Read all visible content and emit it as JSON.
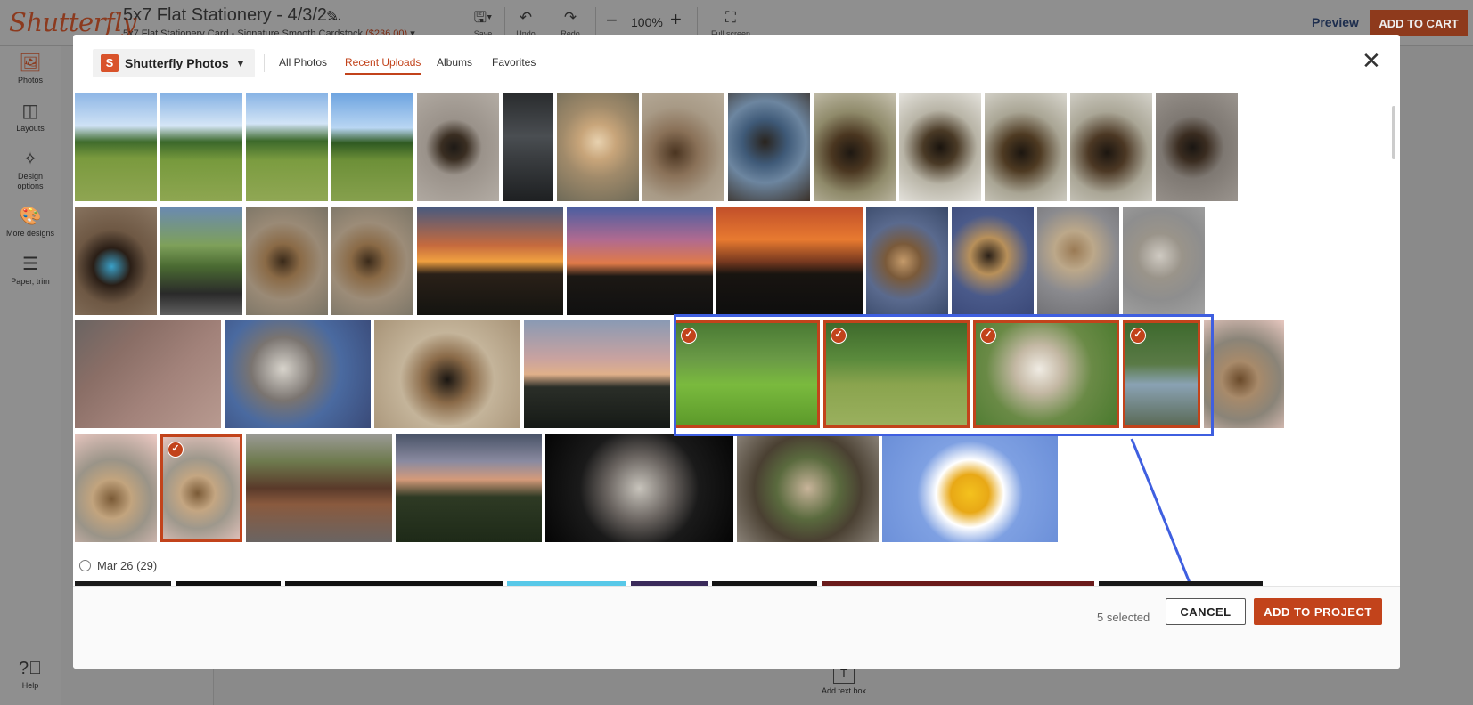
{
  "app": {
    "logo": "Shutterfly",
    "project_title": "5x7 Flat Stationery - 4/3/2...",
    "project_sub": "5x7 Flat Stationery Card - Signature Smooth Cardstock",
    "project_price": "($236.00)"
  },
  "toolbar": {
    "save": "Save",
    "undo": "Undo",
    "redo": "Redo",
    "zoom": "100%",
    "fullscreen": "Full screen",
    "preview": "Preview",
    "add_to_cart": "ADD TO CART"
  },
  "sidebar": {
    "items": [
      {
        "label": "Photos",
        "icon": "photos-icon"
      },
      {
        "label": "Layouts",
        "icon": "layouts-icon"
      },
      {
        "label": "Design options",
        "icon": "design-options-icon"
      },
      {
        "label": "More designs",
        "icon": "palette-icon"
      },
      {
        "label": "Paper, trim",
        "icon": "list-icon"
      }
    ],
    "help": "Help"
  },
  "canvas": {
    "add_text_box": "Add text box"
  },
  "modal": {
    "source": "Shutterfly Photos",
    "tabs": [
      "All Photos",
      "Recent Uploads",
      "Albums",
      "Favorites"
    ],
    "active_tab": "Recent Uploads",
    "date_group": "Mar 26 (29)",
    "selected_count": "5 selected",
    "cancel": "CANCEL",
    "add_to_project": "ADD TO PROJECT"
  },
  "colors": {
    "accent": "#c2431b",
    "selection_frame": "#3f5fe0",
    "brand_dark": "#8c3a1e"
  },
  "photos": [
    {
      "name": "photo-horses-1",
      "selected": false,
      "bg": "linear-gradient(180deg,#8fb7e6 0%,#cfe2f5 30%,#3f6b2c 45%,#7a9a3e 60%,#8fa552 100%)"
    },
    {
      "name": "photo-horses-2",
      "selected": false,
      "bg": "linear-gradient(180deg,#86b2e4 0%,#d6e6f6 30%,#3a672a 45%,#779a3d 62%,#8ea651 100%)"
    },
    {
      "name": "photo-horses-3",
      "selected": false,
      "bg": "linear-gradient(180deg,#89b4e5 0%,#d2e4f6 28%,#3c692b 44%,#7b9c40 62%,#90a754 100%)"
    },
    {
      "name": "photo-horses-4",
      "selected": false,
      "bg": "linear-gradient(180deg,#6ea4e0 0%,#b9d6f3 32%,#2f5a22 46%,#6d9038 62%,#86a04d 100%)"
    },
    {
      "name": "photo-dog-toy",
      "selected": false,
      "bg": "radial-gradient(circle at 45% 50%,#1e1a16 0%,#3a2e22 18%,#9a928a 40%,#b3aca4 100%)"
    },
    {
      "name": "photo-phone-screenshot",
      "selected": false,
      "bg": "linear-gradient(180deg,#2a2c2e 0%,#4a4e52 40%,#3a3d40 60%,#1e2022 100%)"
    },
    {
      "name": "photo-dog-blanket",
      "selected": false,
      "bg": "radial-gradient(circle at 50% 45%,#e8d2b0 0%,#c8a57a 25%,#a08a6a 50%,#6e6a58 100%)"
    },
    {
      "name": "photo-dog-floor",
      "selected": false,
      "bg": "radial-gradient(circle at 40% 55%,#4a3420 0%,#8a7158 30%,#a89a86 60%,#b8ad9c 100%)"
    },
    {
      "name": "photo-dog-bed",
      "selected": false,
      "bg": "radial-gradient(circle at 45% 45%,#2a241e 0%,#3f5a78 30%,#6d86a0 55%,#3a3028 100%)"
    },
    {
      "name": "photo-dog-window-1",
      "selected": false,
      "bg": "radial-gradient(circle at 45% 55%,#1e1812 0%,#4a3620 25%,#8f8a6a 55%,#c7c2b0 100%)"
    },
    {
      "name": "photo-dog-window-2",
      "selected": false,
      "bg": "radial-gradient(circle at 50% 50%,#1a140e 0%,#4a3a26 25%,#b8b4a6 55%,#e4e2dc 100%)"
    },
    {
      "name": "photo-dog-window-3",
      "selected": false,
      "bg": "radial-gradient(circle at 45% 55%,#1c1610 0%,#4e3a22 25%,#a9a594 55%,#d8d6ce 100%)"
    },
    {
      "name": "photo-dog-window-4",
      "selected": false,
      "bg": "radial-gradient(circle at 45% 55%,#1c1610 0%,#4c3824 25%,#aaa696 55%,#d4d2ca 100%)"
    },
    {
      "name": "photo-dog-carpet",
      "selected": false,
      "bg": "radial-gradient(circle at 45% 50%,#1a1612 0%,#3a2c20 20%,#7e7872 45%,#9a948e 100%)"
    },
    {
      "name": "photo-dog-sweater",
      "selected": false,
      "bg": "radial-gradient(circle at 45% 55%,#3aa0c8 0%,#2a1e16 25%,#6e5844 50%,#8a7662 100%)"
    },
    {
      "name": "photo-dog-outdoor-box",
      "selected": false,
      "bg": "linear-gradient(180deg,#6a8ab0 0%,#7ea05a 35%,#4a6a32 55%,#2a2a2a 80%,#606060 100%)"
    },
    {
      "name": "photo-dog-stairs-1",
      "selected": false,
      "bg": "radial-gradient(circle at 45% 50%,#3a2a1a 0%,#8a6a46 25%,#9a8a76 55%,#7a7466 100%)"
    },
    {
      "name": "photo-dog-stairs-2",
      "selected": false,
      "bg": "radial-gradient(circle at 45% 50%,#3a2a1a 0%,#8a6a46 25%,#9c8c78 55%,#7c7668 100%)"
    },
    {
      "name": "photo-sunset-1",
      "selected": false,
      "bg": "linear-gradient(180deg,#4a5a7e 0%,#c56a3e 35%,#f0a040 50%,#2a2018 62%,#141410 100%)"
    },
    {
      "name": "photo-sunset-2",
      "selected": false,
      "bg": "linear-gradient(180deg,#4c5ea0 0%,#b06a90 30%,#e07a48 52%,#1c1814 64%,#101010 100%)"
    },
    {
      "name": "photo-sunset-3",
      "selected": false,
      "bg": "linear-gradient(180deg,#c2502a 0%,#e87a30 30%,#7a3a20 50%,#181410 62%,#0e0e0e 100%)"
    },
    {
      "name": "photo-dog-candy-1",
      "selected": false,
      "bg": "radial-gradient(circle at 45% 50%,#c49a6a 0%,#7a5a3a 25%,#5a6a8e 55%,#3a4a6a 100%)"
    },
    {
      "name": "photo-dog-candy-2",
      "selected": false,
      "bg": "radial-gradient(circle at 45% 45%,#2a2018 0%,#b8905a 25%,#4a5a8a 55%,#3a4878 100%)"
    },
    {
      "name": "photo-dog-plaid",
      "selected": false,
      "bg": "radial-gradient(circle at 45% 40%,#9a7a54 0%,#bca88a 25%,#8a8a8e 55%,#6e6e72 100%)"
    },
    {
      "name": "photo-dog-gray",
      "selected": false,
      "bg": "radial-gradient(circle at 45% 45%,#cfcac2 0%,#9a948a 30%,#8e8e8e 60%,#a2a2a2 100%)"
    },
    {
      "name": "photo-dog-pink-floor",
      "selected": false,
      "bg": "linear-gradient(135deg,#6a6462 0%,#8a6e66 30%,#a2827a 60%,#b89a90 100%)"
    },
    {
      "name": "photo-dog-closeup-1",
      "selected": false,
      "bg": "radial-gradient(circle at 40% 45%,#d8d4cc 0%,#7a7470 30%,#4a6aa0 55%,#3a4a78 100%)"
    },
    {
      "name": "photo-dog-closeup-2",
      "selected": false,
      "bg": "radial-gradient(circle at 50% 55%,#1a1612 0%,#8a6a48 25%,#c4b49a 50%,#a89478 100%)"
    },
    {
      "name": "photo-sunset-tree",
      "selected": false,
      "bg": "linear-gradient(180deg,#8a9ab4 0%,#c8a2a0 35%,#e0b08a 50%,#2a2e28 62%,#161a16 100%)"
    },
    {
      "name": "photo-dog-grass-1",
      "selected": true,
      "bg": "linear-gradient(180deg,#4a7a34 0%,#6a9a46 35%,#7aba3e 60%,#5c9a2a 100%)"
    },
    {
      "name": "photo-dog-grass-2",
      "selected": true,
      "bg": "linear-gradient(180deg,#3e6a2c 0%,#5a8a3c 35%,#8aa44e 60%,#9ab05e 100%)"
    },
    {
      "name": "photo-dog-grass-closeup",
      "selected": true,
      "bg": "radial-gradient(circle at 45% 45%,#f0ece4 0%,#c4b8a4 25%,#6a8a46 55%,#4a7a2e 100%)"
    },
    {
      "name": "photo-dog-chair",
      "selected": true,
      "bg": "linear-gradient(180deg,#3e6a2e 0%,#5a7a46 40%,#8aa2b4 60%,#5a6a56 100%)"
    },
    {
      "name": "photo-dog-vase-1",
      "selected": false,
      "bg": "radial-gradient(circle at 45% 55%,#6a4a2a 0%,#a88a6a 25%,#8a8478 55%,#e8c8c0 100%)"
    },
    {
      "name": "photo-dog-vase-2",
      "selected": false,
      "bg": "radial-gradient(circle at 45% 60%,#7a5a36 0%,#c2a47e 25%,#9a9488 50%,#eecac4 100%)"
    },
    {
      "name": "photo-dog-vase-3",
      "selected": true,
      "bg": "radial-gradient(circle at 45% 55%,#7a5a36 0%,#c4a682 25%,#9e988c 50%,#f0cac4 100%)"
    },
    {
      "name": "photo-dog-porch-swing",
      "selected": false,
      "bg": "linear-gradient(180deg,#9a9a94 0%,#6e7a4e 25%,#5a3a2a 50%,#8a5a3e 65%,#6a6462 100%)"
    },
    {
      "name": "photo-sunset-clouds",
      "selected": false,
      "bg": "linear-gradient(180deg,#4a5468 0%,#8a8aa0 25%,#d49a7a 42%,#2e3a24 58%,#1e2a18 100%)"
    },
    {
      "name": "photo-dog-black-bg",
      "selected": false,
      "bg": "radial-gradient(circle at 50% 50%,#c8c4bc 0%,#6a6460 30%,#1a1a1a 55%,#050505 100%)"
    },
    {
      "name": "photo-couple-frame",
      "selected": false,
      "bg": "radial-gradient(circle at 50% 50%,#c8b49a 0%,#5a6a3e 35%,#4a4032 60%,#8a8278 100%)"
    },
    {
      "name": "photo-pooh-bear",
      "selected": false,
      "bg": "radial-gradient(circle at 50% 55%,#f4c21e 0%,#e8a816 18%,#ffffff 32%,#7ea0e2 50%,#6a8ed8 100%)"
    }
  ],
  "strip": [
    {
      "color": "#1a1a1a"
    },
    {
      "color": "#101010"
    },
    {
      "color": "#111111"
    },
    {
      "color": "#58c8e8"
    },
    {
      "color": "#3a2a5a"
    },
    {
      "color": "#151515"
    },
    {
      "color": "#6a1a1a"
    },
    {
      "color": "#181818"
    }
  ]
}
